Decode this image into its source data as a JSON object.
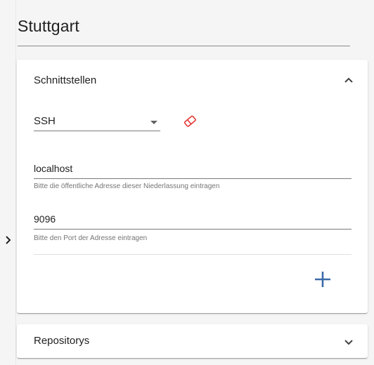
{
  "page": {
    "title": "Stuttgart"
  },
  "interfaces_panel": {
    "title": "Schnittstellen",
    "protocol": {
      "selected": "SSH"
    },
    "address": {
      "value": "localhost",
      "hint": "Bitte die öffentliche Adresse dieser Niederlassung eintragen"
    },
    "port": {
      "value": "9096",
      "hint": "Bitte den Port der Adresse eintragen"
    }
  },
  "repos_panel": {
    "title": "Repositorys"
  },
  "colors": {
    "accent": "#3d6aa8",
    "danger": "#e53935",
    "text": "#212121",
    "hint": "#757575"
  },
  "icons": [
    "chevron-right-icon",
    "chevron-up-icon",
    "eraser-icon",
    "plus-icon",
    "chevron-down-icon"
  ]
}
